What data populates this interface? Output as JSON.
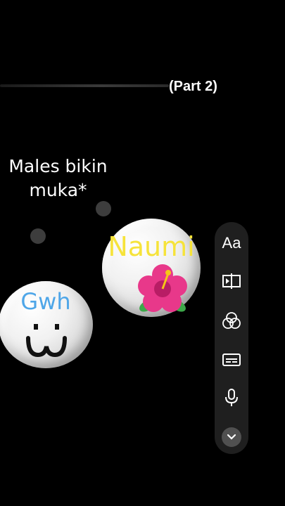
{
  "header": {
    "part_label": "(Part 2)"
  },
  "caption": {
    "line1": "Males bikin",
    "line2": "muka*"
  },
  "bubbles": {
    "naumi": {
      "name": "Naumi",
      "emoji": "hibiscus"
    },
    "gwh": {
      "name": "Gwh",
      "face": "ω"
    }
  },
  "toolbar": {
    "text_label": "Aa",
    "icons": [
      "text-icon",
      "split-icon",
      "filters-icon",
      "captions-icon",
      "mic-icon",
      "chevron-down-icon"
    ]
  },
  "colors": {
    "naumi": "#f6e33a",
    "gwh": "#4ea6e8",
    "background": "#000000",
    "toolbar": "#1f1f1f"
  }
}
